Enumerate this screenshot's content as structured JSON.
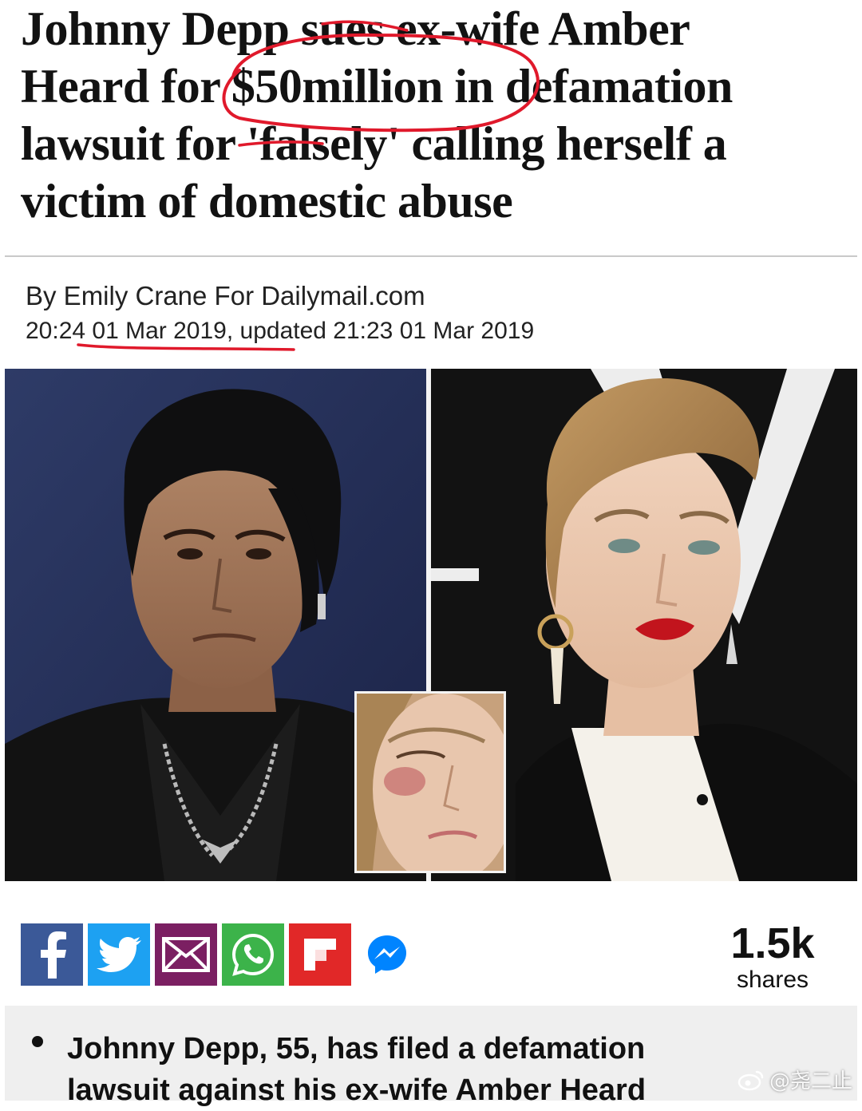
{
  "article": {
    "headline_lines": [
      "Johnny Depp sues ex-wife Amber",
      "Heard for $50million in defamation",
      "lawsuit for 'falsely' calling herself a",
      "victim of domestic abuse"
    ],
    "byline": "By Emily Crane For Dailymail.com",
    "dateline": "20:24 01 Mar 2019, updated 21:23 01 Mar 2019"
  },
  "share": {
    "buttons": [
      {
        "name": "facebook",
        "icon": "facebook-icon",
        "color": "#3b5998"
      },
      {
        "name": "twitter",
        "icon": "twitter-icon",
        "color": "#1da1f2"
      },
      {
        "name": "email",
        "icon": "email-icon",
        "color": "#7b1f62"
      },
      {
        "name": "whatsapp",
        "icon": "whatsapp-icon",
        "color": "#3cb34a"
      },
      {
        "name": "flipboard",
        "icon": "flipboard-icon",
        "color": "#e12828"
      },
      {
        "name": "messenger",
        "icon": "messenger-icon",
        "color": "#0084ff"
      }
    ],
    "count": "1.5k",
    "count_label": "shares"
  },
  "summary": {
    "bullets": [
      "Johnny Depp, 55, has filed a defamation",
      "lawsuit against his ex-wife Amber Heard"
    ]
  },
  "watermark": {
    "text": "@尧二止"
  },
  "annotations": {
    "color": "#e0192b"
  }
}
